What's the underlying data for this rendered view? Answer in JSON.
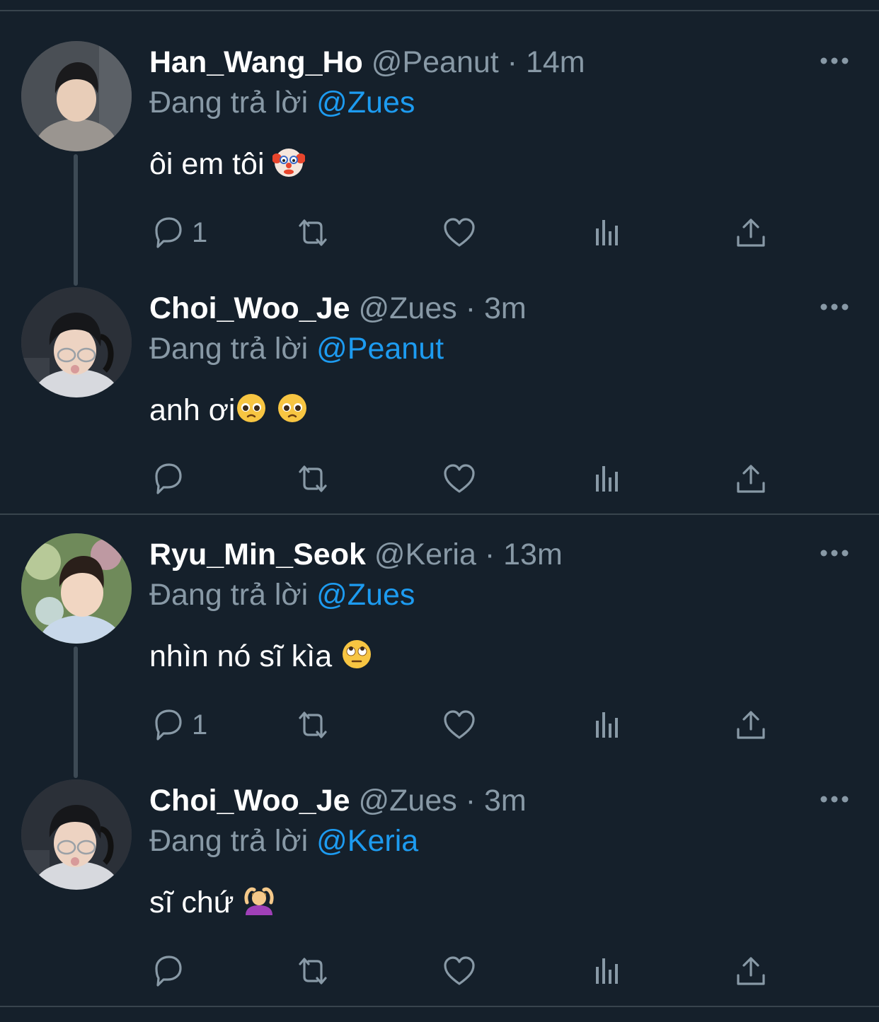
{
  "tweets": [
    {
      "name": "Han_Wang_Ho",
      "handle": "@Peanut",
      "time": "14m",
      "replying_prefix": "Đang trả lời",
      "replying_to": "@Zues",
      "text": "ôi em tôi",
      "emoji": "clown-face",
      "reply_count": "1"
    },
    {
      "name": "Choi_Woo_Je",
      "handle": "@Zues",
      "time": "3m",
      "replying_prefix": "Đang trả lời",
      "replying_to": "@Peanut",
      "text": "anh ơi",
      "emoji": "pleading-face",
      "reply_count": ""
    },
    {
      "name": "Ryu_Min_Seok",
      "handle": "@Keria",
      "time": "13m",
      "replying_prefix": "Đang trả lời",
      "replying_to": "@Zues",
      "text": "nhìn nó sĩ kìa",
      "emoji": "face-with-rolling-eyes",
      "reply_count": "1"
    },
    {
      "name": "Choi_Woo_Je",
      "handle": "@Zues",
      "time": "3m",
      "replying_prefix": "Đang trả lời",
      "replying_to": "@Keria",
      "text": "sĩ chứ",
      "emoji": "person-gesturing-ok",
      "reply_count": ""
    }
  ],
  "separator": "·",
  "icons": [
    "more-icon",
    "reply-icon",
    "retweet-icon",
    "like-icon",
    "analytics-icon",
    "share-icon"
  ],
  "colors": {
    "background": "#15202b",
    "text_primary": "#ffffff",
    "text_secondary": "#8899a6",
    "mention": "#1d9bf0",
    "divider": "#38444d"
  }
}
